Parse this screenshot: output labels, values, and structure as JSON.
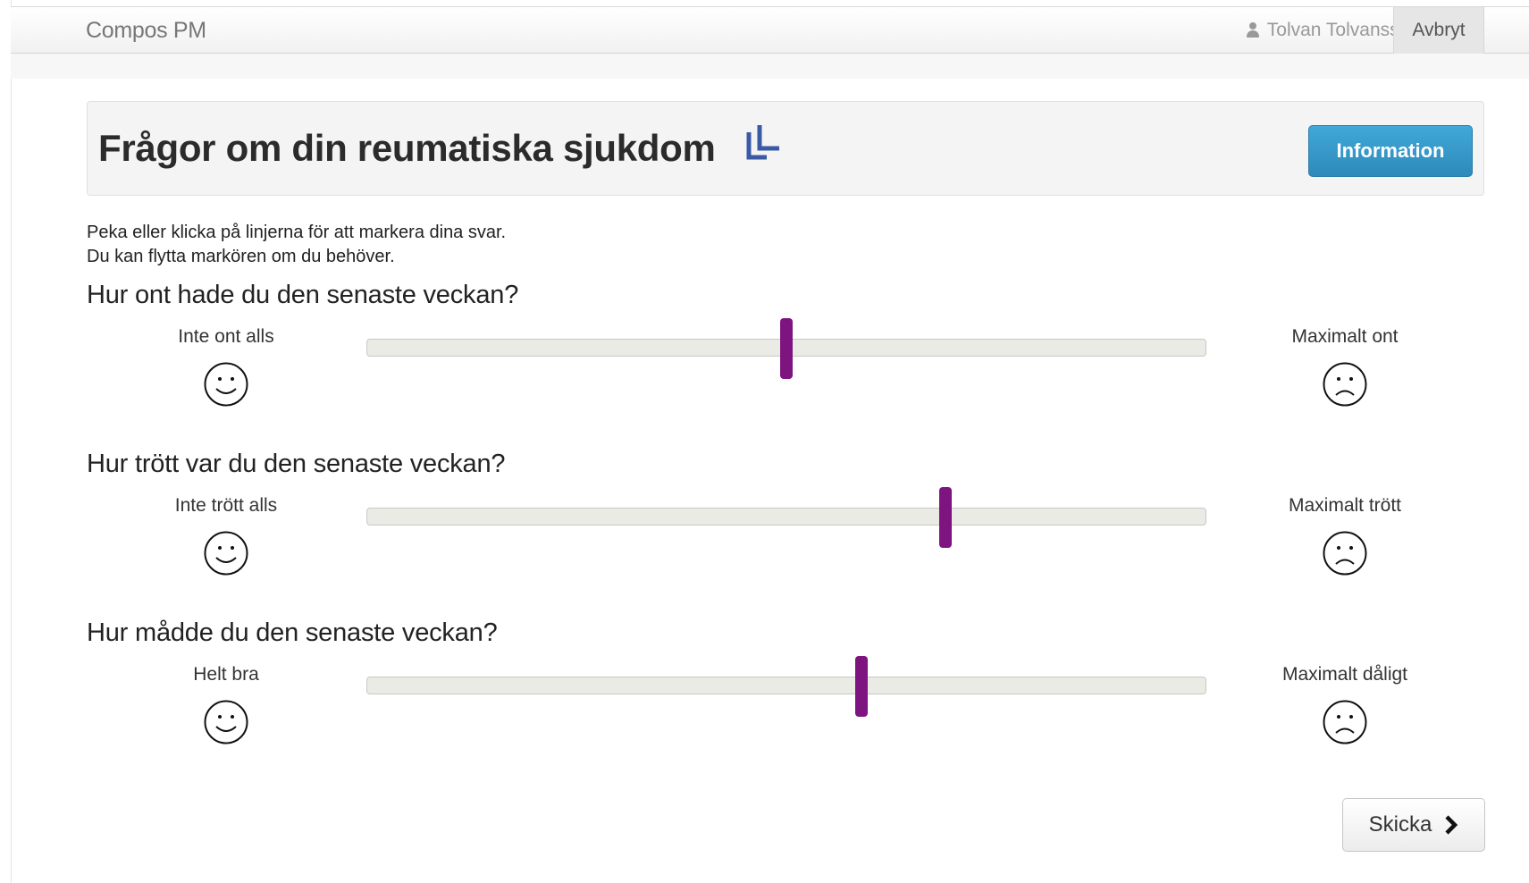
{
  "navbar": {
    "brand": "Compos PM",
    "user_name": "Tolvan Tolvansson",
    "cancel_label": "Avbryt"
  },
  "header": {
    "title": "Frågor om din reumatiska sjukdom",
    "info_label": "Information",
    "accent_color": "#3b5aa6",
    "button_color": "#3399cc"
  },
  "intro": {
    "line1": "Peka eller klicka på linjerna för att markera dina svar.",
    "line2": "Du kan flytta markören om du behöver."
  },
  "questions": [
    {
      "text": "Hur ont hade du den senaste veckan?",
      "min_label": "Inte ont alls",
      "max_label": "Maximalt ont",
      "value": 0.5
    },
    {
      "text": "Hur trött var du den senaste veckan?",
      "min_label": "Inte trött alls",
      "max_label": "Maximalt trött",
      "value": 0.69
    },
    {
      "text": "Hur mådde du den senaste veckan?",
      "min_label": "Helt bra",
      "max_label": "Maximalt dåligt",
      "value": 0.59
    }
  ],
  "slider_color": "#7d1480",
  "submit": {
    "label": "Skicka",
    "icon": "chevron-right-icon"
  }
}
